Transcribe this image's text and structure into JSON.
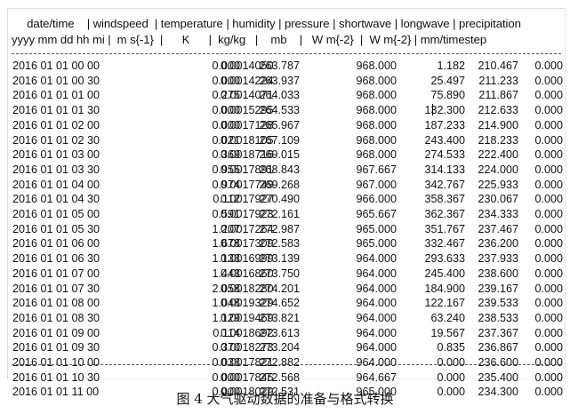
{
  "header": {
    "line1": "  date/time    | windspeed  | temperature | humidity | pressure | shortwave | longwave | precipitation",
    "line2": "yyyy mm dd hh mi |  m s{-1}  |      K      |  kg/kg   |    mb    |   W m{-2}  |  W m{-2} | mm/timestep"
  },
  "rows": [
    [
      "2016 01 01 00 00",
      "0.000",
      "263.787",
      "0.0014050",
      "968.000",
      "1.182",
      "210.467",
      "0.000"
    ],
    [
      "2016 01 01 00 30",
      "0.000",
      "263.937",
      "0.0014224",
      "968.000",
      "25.497",
      "211.233",
      "0.000"
    ],
    [
      "2016 01 01 01 00",
      "0.275",
      "264.033",
      "0.0014071",
      "968.000",
      "75.890",
      "211.867",
      "0.000"
    ],
    [
      "2016 01 01 01 30",
      "0.000",
      "264.533",
      "0.0015295",
      "968.000",
      "132.300",
      "212.633",
      "0.000"
    ],
    [
      "2016 01 01 02 00",
      "0.000",
      "265.967",
      "0.0017128",
      "968.000",
      "187.233",
      "214.900",
      "0.000"
    ],
    [
      "2016 01 01 02 30",
      "0.021",
      "267.109",
      "0.0018105",
      "968.000",
      "243.400",
      "218.233",
      "0.000"
    ],
    [
      "2016 01 01 03 00",
      "0.369",
      "269.015",
      "0.0018716",
      "968.000",
      "274.533",
      "222.400",
      "0.000"
    ],
    [
      "2016 01 01 03 30",
      "0.955",
      "268.843",
      "0.0017891",
      "967.667",
      "314.133",
      "224.000",
      "0.000"
    ],
    [
      "2016 01 01 04 00",
      "0.974",
      "269.268",
      "0.0017749",
      "967.000",
      "342.767",
      "225.933",
      "0.000"
    ],
    [
      "2016 01 01 04 30",
      "0.112",
      "270.490",
      "0.0017927",
      "966.000",
      "358.367",
      "230.067",
      "0.000"
    ],
    [
      "2016 01 01 05 00",
      "0.591",
      "272.161",
      "0.0017923",
      "965.667",
      "362.367",
      "234.333",
      "0.000"
    ],
    [
      "2016 01 01 05 30",
      "1.207",
      "272.987",
      "0.0017264",
      "965.000",
      "351.767",
      "237.467",
      "0.000"
    ],
    [
      "2016 01 01 06 00",
      "1.678",
      "272.583",
      "0.0017309",
      "965.000",
      "332.467",
      "236.200",
      "0.000"
    ],
    [
      "2016 01 01 06 30",
      "1.133",
      "273.139",
      "0.0016999",
      "964.000",
      "293.633",
      "237.933",
      "0.000"
    ],
    [
      "2016 01 01 07 00",
      "1.443",
      "273.750",
      "0.0016860",
      "964.000",
      "245.400",
      "238.600",
      "0.000"
    ],
    [
      "2016 01 01 07 30",
      "2.058",
      "274.201",
      "0.0018280",
      "964.000",
      "184.900",
      "239.167",
      "0.000"
    ],
    [
      "2016 01 01 08 00",
      "1.048",
      "274.652",
      "0.0019329",
      "964.000",
      "122.167",
      "239.533",
      "0.000"
    ],
    [
      "2016 01 01 08 30",
      "1.129",
      "273.821",
      "0.0019469",
      "964.000",
      "63.240",
      "238.533",
      "0.000"
    ],
    [
      "2016 01 01 09 00",
      "0.114",
      "273.613",
      "0.0018692",
      "964.000",
      "19.567",
      "237.367",
      "0.000"
    ],
    [
      "2016 01 01 09 30",
      "0.370",
      "273.204",
      "0.0018273",
      "964.000",
      "0.835",
      "236.867",
      "0.000"
    ],
    [
      "2016 01 01 10 00",
      "0.033",
      "272.882",
      "0.0017821",
      "964.000",
      "0.000",
      "236.600",
      "0.000"
    ],
    [
      "2016 01 01 10 30",
      "0.000",
      "272.568",
      "0.0017845",
      "964.667",
      "0.000",
      "235.400",
      "0.000"
    ],
    [
      "2016 01 01 11 00",
      "0.000",
      "272.531",
      "0.0018029",
      "965.000",
      "0.000",
      "234.300",
      "0.000"
    ]
  ],
  "caption": "图 4  大气驱动数据的准备与格式转换"
}
